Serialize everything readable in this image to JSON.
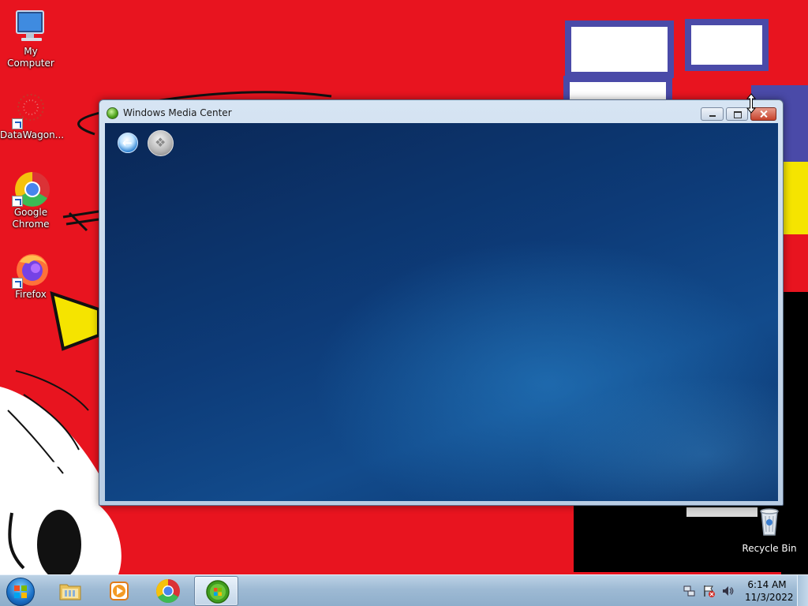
{
  "desktop": {
    "icons": [
      {
        "label": "My Computer",
        "icon": "computer-icon"
      },
      {
        "label": "DataWagon...",
        "icon": "datawagon-icon"
      },
      {
        "label": "Google Chrome",
        "icon": "chrome-icon"
      },
      {
        "label": "Firefox",
        "icon": "firefox-icon"
      },
      {
        "label": "Recycle Bin",
        "icon": "recycle-bin-icon"
      }
    ]
  },
  "window": {
    "title": "Windows Media Center",
    "controls": [
      "minimize-icon",
      "maximize-icon",
      "close-icon"
    ],
    "toolbar": [
      "back-arrow-icon",
      "windows-orb-icon"
    ]
  },
  "taskbar": {
    "items": [
      "start-orb-icon",
      "file-explorer-icon",
      "media-player-icon",
      "chrome-icon",
      "media-center-icon"
    ],
    "active_item": "Windows Media Center",
    "tray": {
      "icons": [
        "network-icon",
        "action-center-flag-icon",
        "volume-icon"
      ],
      "time": "6:14 AM",
      "date": "11/3/2022"
    }
  },
  "colors": {
    "wallpaper": "#e8141f",
    "taskbar": "#a9c3db",
    "wmc_background": "#0d3b78"
  }
}
